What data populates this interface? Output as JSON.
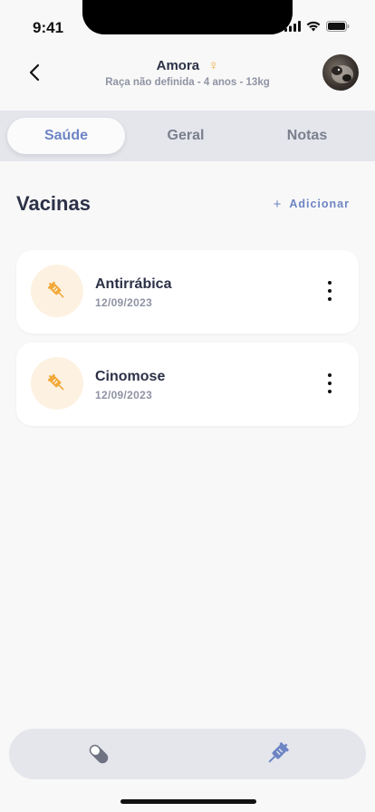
{
  "status_bar": {
    "time": "9:41"
  },
  "header": {
    "pet_name": "Amora",
    "pet_details": "Raça não definida - 4 anos - 13kg",
    "sex_icon": "female-icon",
    "avatar": "pet-avatar"
  },
  "tabs": [
    {
      "label": "Saúde",
      "active": true
    },
    {
      "label": "Geral",
      "active": false
    },
    {
      "label": "Notas",
      "active": false
    }
  ],
  "section": {
    "title": "Vacinas",
    "add_label": "Adicionar",
    "add_icon": "plus-icon"
  },
  "vaccines": [
    {
      "name": "Antirrábica",
      "date": "12/09/2023",
      "icon": "syringe-icon"
    },
    {
      "name": "Cinomose",
      "date": "12/09/2023",
      "icon": "syringe-icon"
    }
  ],
  "bottom_nav": [
    {
      "icon": "pill-icon",
      "active": false
    },
    {
      "icon": "syringe-icon",
      "active": true
    }
  ],
  "colors": {
    "accent": "#6d85c4",
    "orange": "#f2a93b",
    "text": "#2c3147",
    "muted": "#8f93a3"
  }
}
